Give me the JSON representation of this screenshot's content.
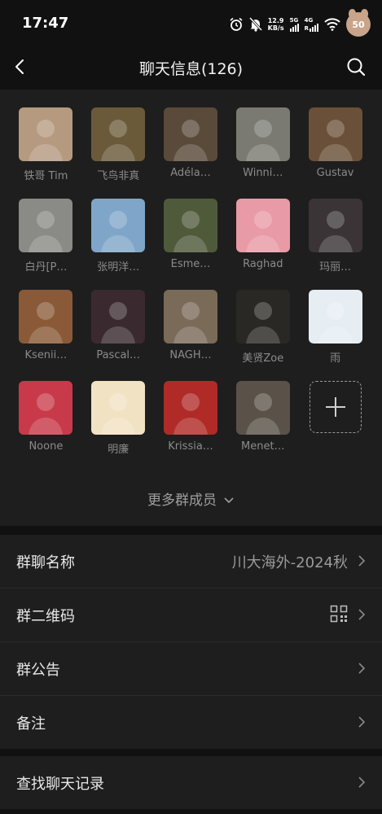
{
  "status_bar": {
    "time": "17:47",
    "speed_value": "12.9",
    "speed_unit": "KB/s",
    "net1": "5G",
    "net2": "4G",
    "net2_sub": "R",
    "battery": "50"
  },
  "header": {
    "title": "聊天信息(126)",
    "back_icon": "chevron-left-icon",
    "search_icon": "search-icon"
  },
  "members": [
    {
      "name": "铁哥 Tim",
      "color": "#b59a80"
    },
    {
      "name": "飞鸟非真",
      "color": "#6a5a3a"
    },
    {
      "name": "Adéla…",
      "color": "#5a4a3a"
    },
    {
      "name": "Winni…",
      "color": "#7a7a72"
    },
    {
      "name": "Gustav",
      "color": "#6a5038"
    },
    {
      "name": "白丹[P…",
      "color": "#8a8a86"
    },
    {
      "name": "张明洋…",
      "color": "#7fa6c8"
    },
    {
      "name": "Esme…",
      "color": "#4f5a3a"
    },
    {
      "name": "Raghad",
      "color": "#e89aa6"
    },
    {
      "name": "玛丽…",
      "color": "#3a3436"
    },
    {
      "name": "Ksenii…",
      "color": "#8a5a38"
    },
    {
      "name": "Pascal…",
      "color": "#3a2a30"
    },
    {
      "name": "NAGH…",
      "color": "#7a6a58"
    },
    {
      "name": "美贤Zoe",
      "color": "#2a2824"
    },
    {
      "name": "雨",
      "color": "#e6eef4"
    },
    {
      "name": "Noone",
      "color": "#c83a4a"
    },
    {
      "name": "明廉",
      "color": "#f2e2c4"
    },
    {
      "name": "Krissia…",
      "color": "#b02a28"
    },
    {
      "name": "Menet…",
      "color": "#5a5248"
    }
  ],
  "add_member_icon": "plus-icon",
  "more_members": "更多群成员",
  "settings_group1": [
    {
      "label": "群聊名称",
      "value": "川大海外-2024秋"
    },
    {
      "label": "群二维码",
      "value": ""
    },
    {
      "label": "群公告",
      "value": ""
    },
    {
      "label": "备注",
      "value": ""
    }
  ],
  "settings_group2": [
    {
      "label": "查找聊天记录",
      "value": ""
    }
  ]
}
